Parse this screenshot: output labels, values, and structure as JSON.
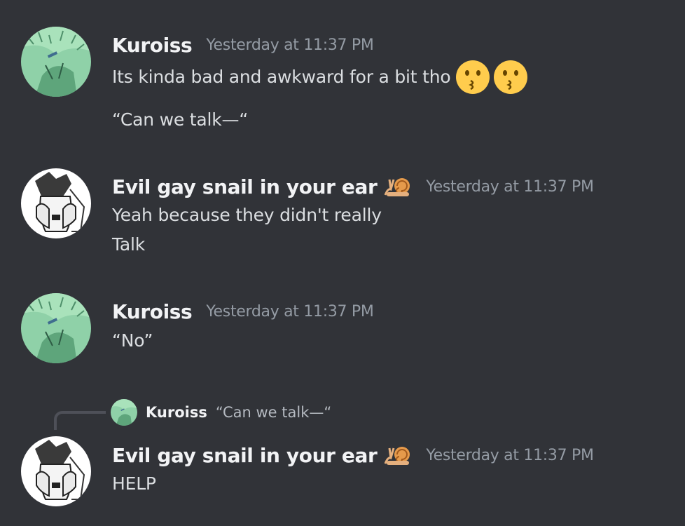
{
  "messages": [
    {
      "author": "Kuroiss",
      "timestamp": "Yesterday at 11:37 PM",
      "lines": [
        "Its kinda bad and awkward for a bit tho",
        "“Can we talk—“"
      ],
      "emojis": [
        "kissing-face",
        "kissing-face"
      ]
    },
    {
      "author": "Evil gay snail in your ear",
      "role_icon": "snail",
      "timestamp": "Yesterday at 11:37 PM",
      "lines": [
        "Yeah because they didn't really",
        "Talk"
      ]
    },
    {
      "author": "Kuroiss",
      "timestamp": "Yesterday at 11:37 PM",
      "lines": [
        "“No”"
      ]
    },
    {
      "reply_to": {
        "author": "Kuroiss",
        "text": "“Can we talk—“"
      },
      "author": "Evil gay snail in your ear",
      "role_icon": "snail",
      "timestamp": "Yesterday at 11:37 PM",
      "lines": [
        "HELP"
      ]
    }
  ],
  "colors": {
    "background": "#313338",
    "username": "#f2f3f5",
    "timestamp": "#949ba4",
    "message_text": "#dbdee1",
    "reply_spine": "#4e5058"
  }
}
